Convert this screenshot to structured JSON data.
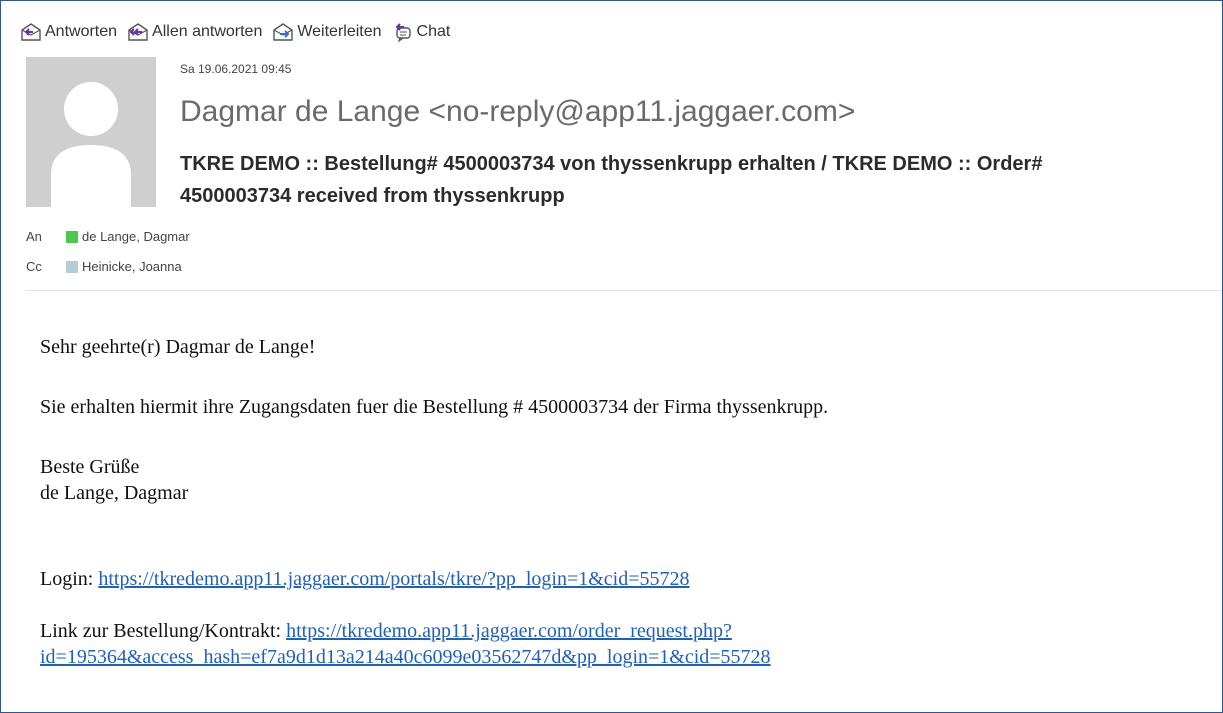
{
  "toolbar": {
    "reply": "Antworten",
    "reply_all": "Allen antworten",
    "forward": "Weiterleiten",
    "chat": "Chat"
  },
  "message": {
    "date": "Sa 19.06.2021 09:45",
    "sender": "Dagmar de Lange <no-reply@app11.jaggaer.com>",
    "subject_line1": "TKRE DEMO :: Bestellung# 4500003734 von thyssenkrupp erhalten / TKRE DEMO :: Order#",
    "subject_line2": "4500003734 received from thyssenkrupp"
  },
  "recipients": {
    "to_label": "An",
    "to_name": "de Lange, Dagmar",
    "to_color": "#4cc94c",
    "cc_label": "Cc",
    "cc_name": "Heinicke, Joanna",
    "cc_color": "#b6cbd8"
  },
  "body": {
    "greeting": "Sehr geehrte(r) Dagmar de Lange!",
    "paragraph": "Sie erhalten hiermit ihre Zugangsdaten fuer die Bestellung # 4500003734 der Firma thyssenkrupp.",
    "closing": "Beste Grüße",
    "signature": "de Lange, Dagmar",
    "login_label": "Login: ",
    "login_link": "https://tkredemo.app11.jaggaer.com/portals/tkre/?pp_login=1&cid=55728",
    "order_label": "Link zur Bestellung/Kontrakt: ",
    "order_link_line1": "https://tkredemo.app11.jaggaer.com/order_request.php?",
    "order_link_line2": "id=195364&access_hash=ef7a9d1d13a214a40c6099e03562747d&pp_login=1&cid=55728"
  },
  "colors": {
    "frame_border": "#2f5597",
    "link": "#1f5fbf",
    "reply_arrow": "#2f6fd1"
  }
}
